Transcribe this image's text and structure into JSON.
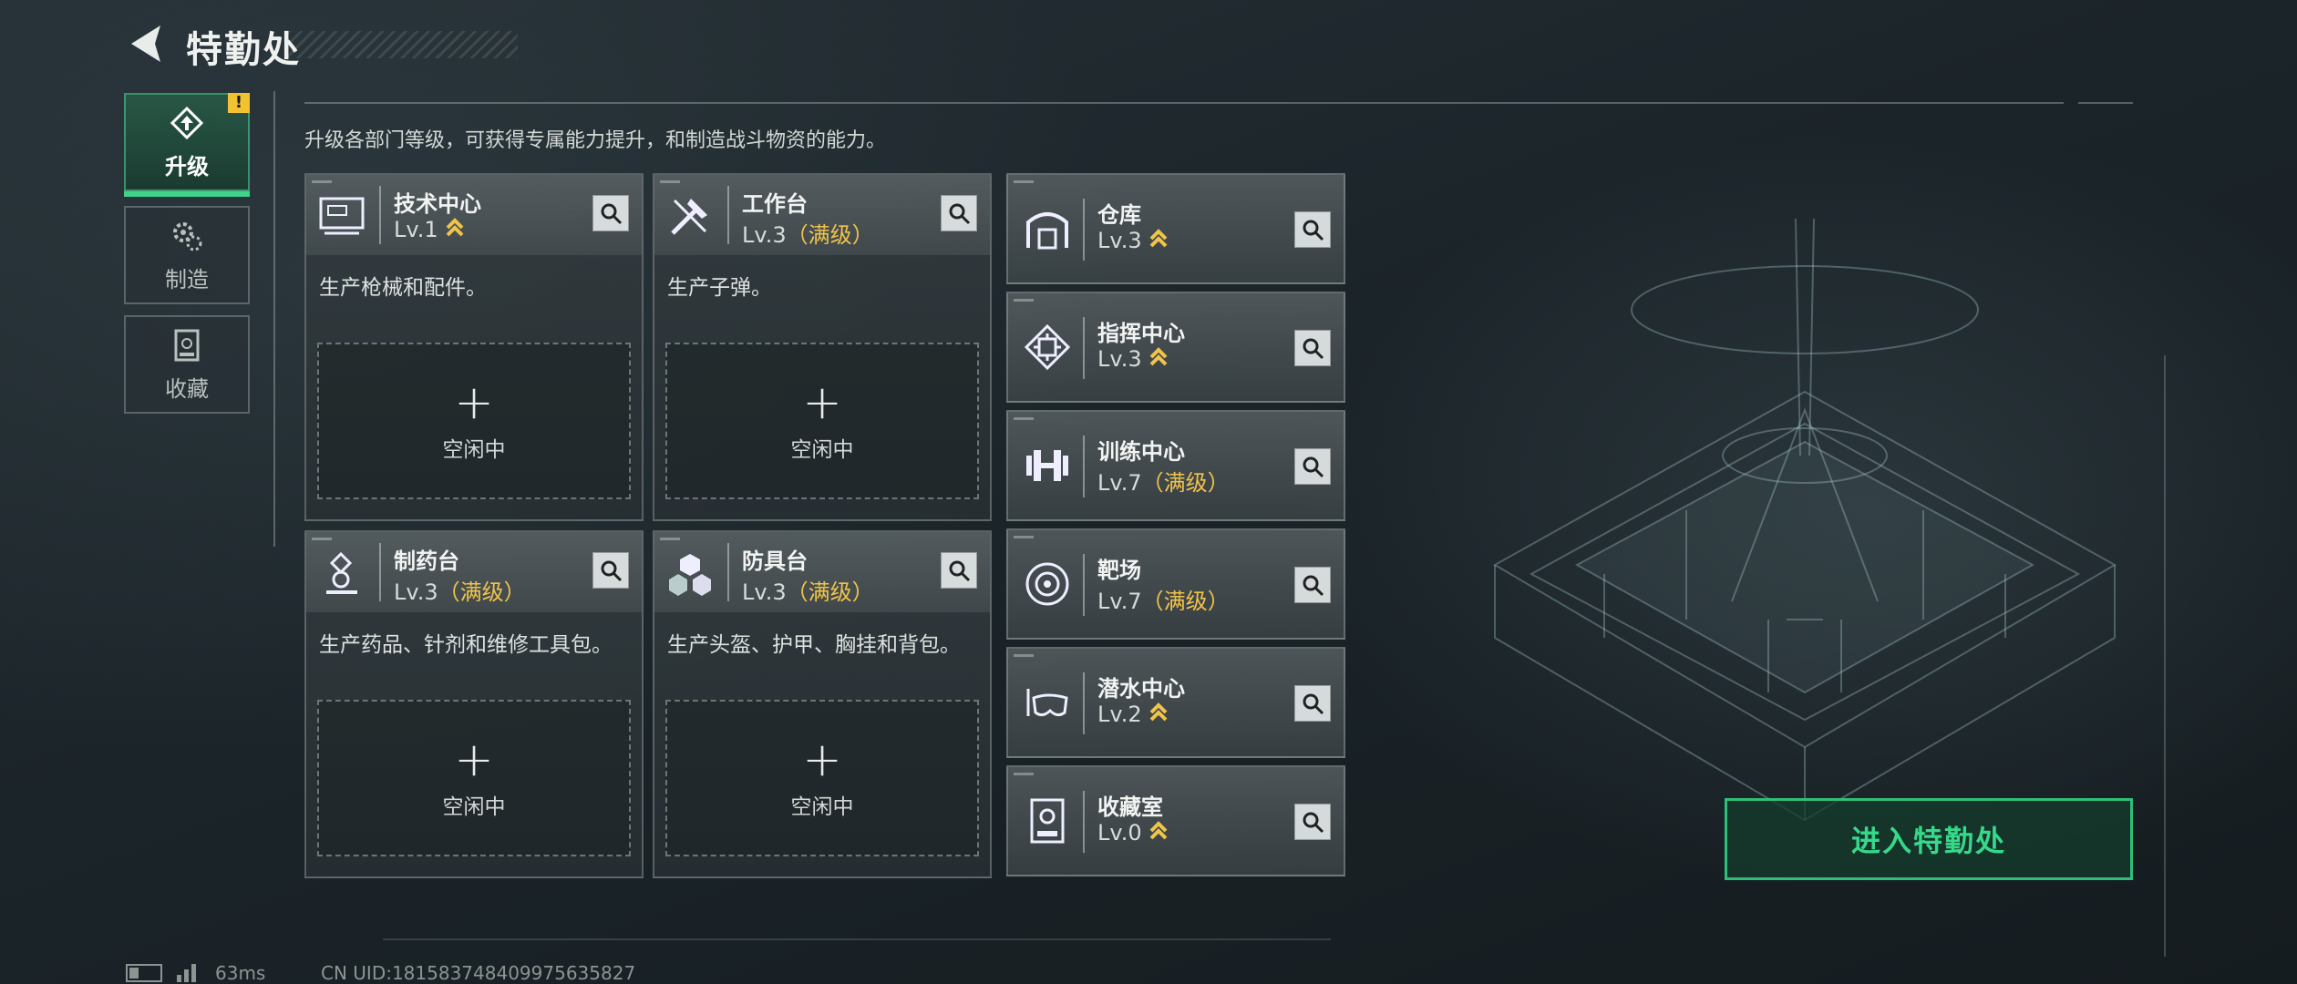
{
  "header": {
    "title": "特勤处"
  },
  "sidebar": {
    "tabs": [
      {
        "label": "升级",
        "active": true,
        "icon": "upgrade-icon"
      },
      {
        "label": "制造",
        "active": false,
        "icon": "gears-icon"
      },
      {
        "label": "收藏",
        "active": false,
        "icon": "collection-icon"
      }
    ],
    "alert": "!"
  },
  "subtitle": "升级各部门等级，可获得专属能力提升，和制造战斗物资的能力。",
  "workshops": [
    {
      "name": "技术中心",
      "level": "Lv.1",
      "max": "",
      "upgradable": true,
      "desc": "生产枪械和配件。",
      "slot": "空闲中",
      "icon": "terminal-icon"
    },
    {
      "name": "工作台",
      "level": "Lv.3",
      "max": "（满级）",
      "upgradable": false,
      "desc": "生产子弹。",
      "slot": "空闲中",
      "icon": "tools-icon"
    },
    {
      "name": "制药台",
      "level": "Lv.3",
      "max": "（满级）",
      "upgradable": false,
      "desc": "生产药品、针剂和维修工具包。",
      "slot": "空闲中",
      "icon": "microscope-icon"
    },
    {
      "name": "防具台",
      "level": "Lv.3",
      "max": "（满级）",
      "upgradable": false,
      "desc": "生产头盔、护甲、胸挂和背包。",
      "slot": "空闲中",
      "icon": "cubes-icon"
    }
  ],
  "facilities": [
    {
      "name": "仓库",
      "level": "Lv.3",
      "max": "",
      "upgradable": true,
      "icon": "warehouse-icon"
    },
    {
      "name": "指挥中心",
      "level": "Lv.3",
      "max": "",
      "upgradable": true,
      "icon": "chip-icon"
    },
    {
      "name": "训练中心",
      "level": "Lv.7",
      "max": "（满级）",
      "upgradable": false,
      "icon": "dumbbell-icon"
    },
    {
      "name": "靶场",
      "level": "Lv.7",
      "max": "（满级）",
      "upgradable": false,
      "icon": "target-icon"
    },
    {
      "name": "潜水中心",
      "level": "Lv.2",
      "max": "",
      "upgradable": true,
      "icon": "diving-mask-icon"
    },
    {
      "name": "收藏室",
      "level": "Lv.0",
      "max": "",
      "upgradable": true,
      "icon": "display-case-icon"
    }
  ],
  "enter_button": "进入特勤处",
  "footer": {
    "ping": "63ms",
    "uid": "CN UID:18158374840997563582​7"
  },
  "colors": {
    "accent_green": "#36d88a",
    "max_gold": "#f0c34a",
    "alert_yellow": "#f2c230"
  }
}
